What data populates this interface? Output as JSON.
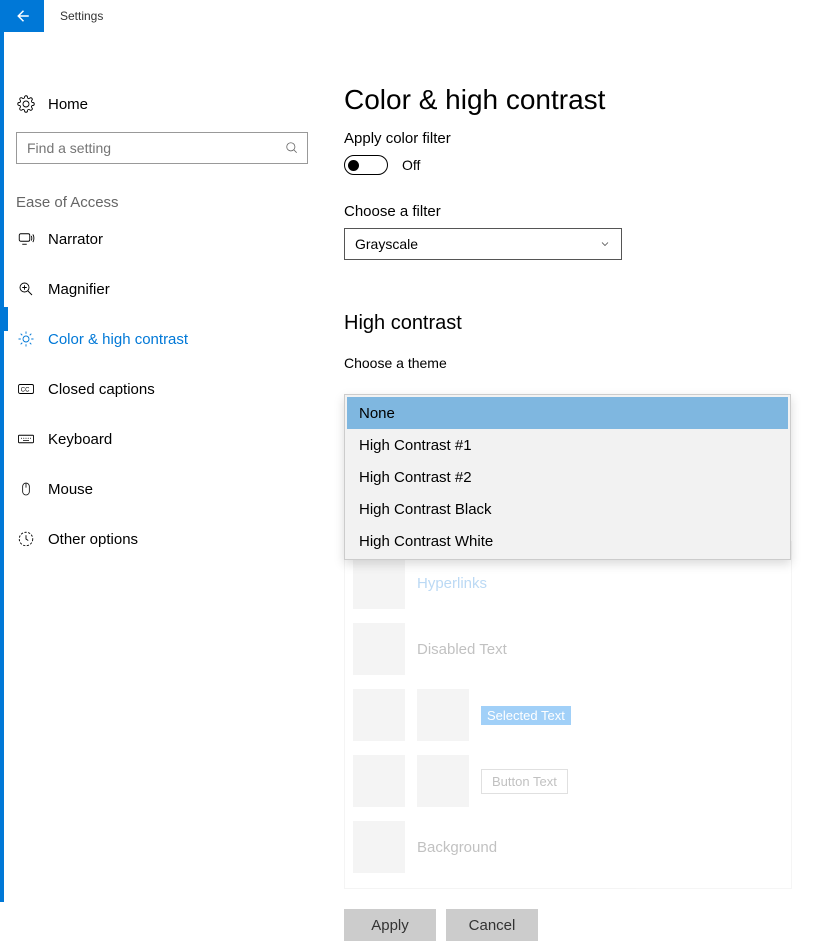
{
  "app": {
    "title": "Settings"
  },
  "nav": {
    "home": "Home",
    "search_placeholder": "Find a setting",
    "category": "Ease of Access",
    "items": [
      {
        "label": "Narrator"
      },
      {
        "label": "Magnifier"
      },
      {
        "label": "Color & high contrast"
      },
      {
        "label": "Closed captions"
      },
      {
        "label": "Keyboard"
      },
      {
        "label": "Mouse"
      },
      {
        "label": "Other options"
      }
    ]
  },
  "page": {
    "title": "Color & high contrast",
    "apply_filter_label": "Apply color filter",
    "toggle_state": "Off",
    "choose_filter_label": "Choose a filter",
    "filter_value": "Grayscale",
    "hc_section": "High contrast",
    "choose_theme_label": "Choose a theme",
    "theme_options": {
      "o0": "None",
      "o1": "High Contrast #1",
      "o2": "High Contrast #2",
      "o3": "High Contrast Black",
      "o4": "High Contrast White"
    },
    "preview": {
      "hyperlinks": "Hyperlinks",
      "disabled": "Disabled Text",
      "selected": "Selected Text",
      "button": "Button Text",
      "background": "Background"
    },
    "apply": "Apply",
    "cancel": "Cancel"
  }
}
